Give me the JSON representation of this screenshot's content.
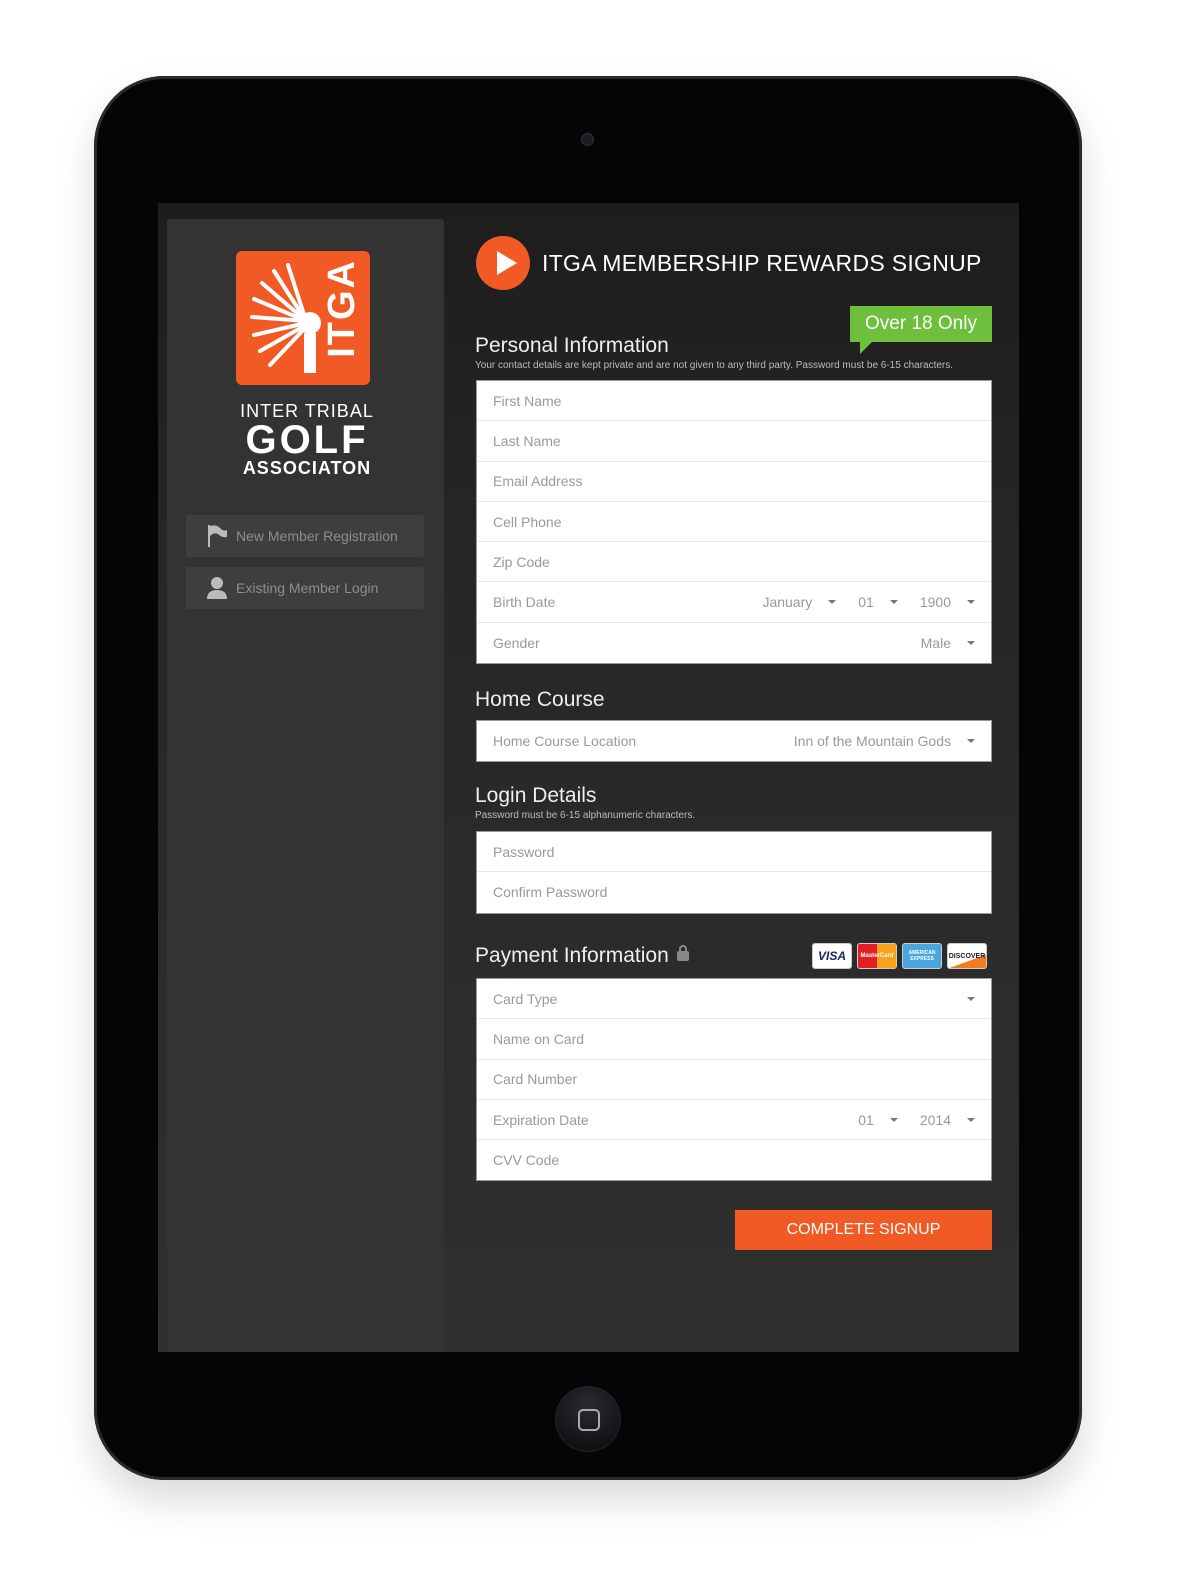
{
  "brand": {
    "logo_text": "ITGA",
    "line1": "INTER TRIBAL",
    "line2": "GOLF",
    "line3": "ASSOCIATON",
    "accent": "#f15a24"
  },
  "sidebar": {
    "items": [
      {
        "label": "New Member Registration",
        "icon": "flag-icon"
      },
      {
        "label": "Existing Member Login",
        "icon": "user-icon"
      }
    ]
  },
  "header": {
    "title": "ITGA MEMBERSHIP REWARDS SIGNUP",
    "badge": "Over 18 Only",
    "badge_color": "#6dbf3c"
  },
  "personal": {
    "heading": "Personal Information",
    "note": "Your contact details are kept private and are not given to any third party. Password must be 6-15 characters.",
    "fields": [
      "First Name",
      "Last Name",
      "Email Address",
      "Cell Phone",
      "Zip Code"
    ],
    "birth": {
      "label": "Birth Date",
      "month": "January",
      "day": "01",
      "year": "1900"
    },
    "gender": {
      "label": "Gender",
      "value": "Male"
    }
  },
  "home_course": {
    "heading": "Home Course",
    "label": "Home Course Location",
    "value": "Inn of the Mountain Gods"
  },
  "login": {
    "heading": "Login Details",
    "note": "Password must be 6-15 alphanumeric characters.",
    "fields": [
      "Password",
      "Confirm Password"
    ]
  },
  "payment": {
    "heading": "Payment Information",
    "cards": [
      "VISA",
      "MasterCard",
      "AMERICAN EXPRESS",
      "DISCOVER"
    ],
    "card_type": "Card Type",
    "name": "Name on Card",
    "number": "Card Number",
    "expiry": {
      "label": "Expiration Date",
      "month": "01",
      "year": "2014"
    },
    "cvv": "CVV Code"
  },
  "submit": "COMPLETE SIGNUP"
}
